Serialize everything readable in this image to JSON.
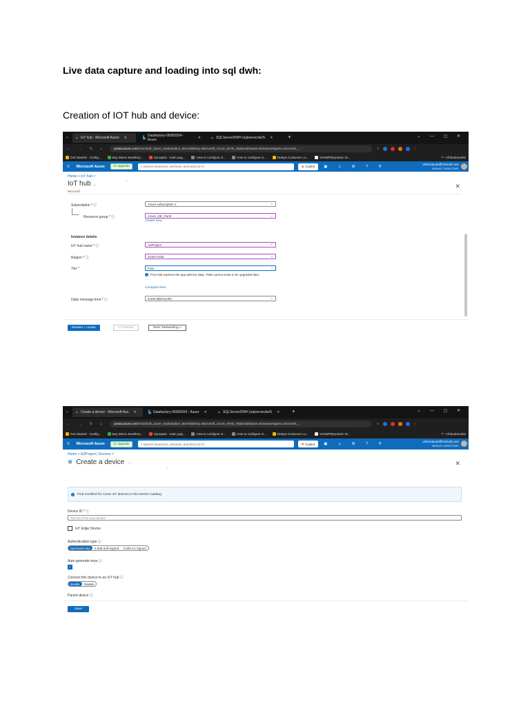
{
  "document": {
    "heading": "Live data capture and loading into sql dwh:",
    "subheading": "Creation of IOT hub and device:"
  },
  "shot1": {
    "tabs": [
      "IoT hub - Microsoft Azure",
      "Datafactory-05082024 - Azure",
      "SQLServerDWH (sqlserverdw/S"
    ],
    "url_host": "portal.azure.com",
    "url_path": "/microsoft_azure_marketplace_ItemHideKey=Microsoft_Azure_WVD_Hidden&feature.showassettypes=microsoft_...",
    "bookmarks": [
      "Get Started - Config...",
      "Buy Mens Jewellery...",
      "Synopsis - main pag...",
      "How to configure S...",
      "How to configure S...",
      "Netsys Customer Lo...",
      "VKDMP|Dynamic M..."
    ],
    "all_bookmarks": "All Bookmarks",
    "brand": "Microsoft Azure",
    "upgrade": "Upgrade",
    "search_placeholder": "Search resources, services, and docs (G+/)",
    "copilot": "Copilot",
    "user_email": "vishnutavat@hotmail.com",
    "user_dir": "DEFAULT DIRECTORY",
    "breadcrumb": "Home > IoT hub >",
    "title": "IoT hub",
    "title_suffix": "...",
    "subtitle": "Microsoft",
    "subscription_label": "Subscription *",
    "subscription_value": "Azure subscription 1",
    "rg_label": "Resource group *",
    "rg_value": "Azure_DE_Part2",
    "create_new": "Create new",
    "instance_details": "Instance details",
    "hub_name_label": "IoT hub name *",
    "hub_name_value": "AZProject",
    "region_label": "Region *",
    "region_value": "South India",
    "tier_label": "Tier *",
    "tier_value": "Free",
    "tier_info": "Free trial explores the app with live data. Trials cannot scale or be upgraded later.",
    "compare_tiers": "Compare tiers",
    "daily_label": "Daily message limit *",
    "daily_value": "8,000 ($0/month)",
    "review_btn": "Review + create",
    "prev_btn": "< Previous",
    "next_btn": "Next: Networking >"
  },
  "shot2": {
    "tabs": [
      "Create a device - Microsoft Azu",
      "Datafactory-05082024 - Azure",
      "SQLServerDWH (sqlserverdw/S"
    ],
    "url_host": "portal.azure.com",
    "url_path": "/microsoft_azure_marketplace_ItemHideKey=Microsoft_Azure_WVD_Hidden&feature.showassettypes=microsoft_...",
    "bookmarks": [
      "Get Started - Config...",
      "Buy Mens Jewellery...",
      "Synopsis - main pag...",
      "How to configure S...",
      "How to configure S...",
      "Netsys Customer Lo...",
      "VKDMP|Dynamic M..."
    ],
    "all_bookmarks": "All Bookmarks",
    "brand": "Microsoft Azure",
    "upgrade": "Upgrade",
    "search_placeholder": "Search resources, services, and docs (G+/)",
    "copilot": "Copilot",
    "user_email": "vishnutavat@hotmail.com",
    "user_dir": "DEFAULT DIRECTORY",
    "breadcrumb": "Home > AZProject | Devices >",
    "title": "Create a device",
    "title_suffix": "...",
    "info_banner": "Find Certified for Azure IoT devices in the Device Catalog",
    "device_id_label": "Device ID *",
    "device_id_placeholder": "The ID of the new device",
    "iot_edge_label": "IoT Edge Device",
    "auth_label": "Authentication type",
    "auth_options": [
      "Symmetric key",
      "X.509 Self-Signed",
      "X.509 CA Signed"
    ],
    "autogen_label": "Auto-generate keys",
    "connect_label": "Connect this device to an IoT hub",
    "connect_options": [
      "Enable",
      "Disable"
    ],
    "parent_label": "Parent device",
    "save_btn": "Save"
  }
}
